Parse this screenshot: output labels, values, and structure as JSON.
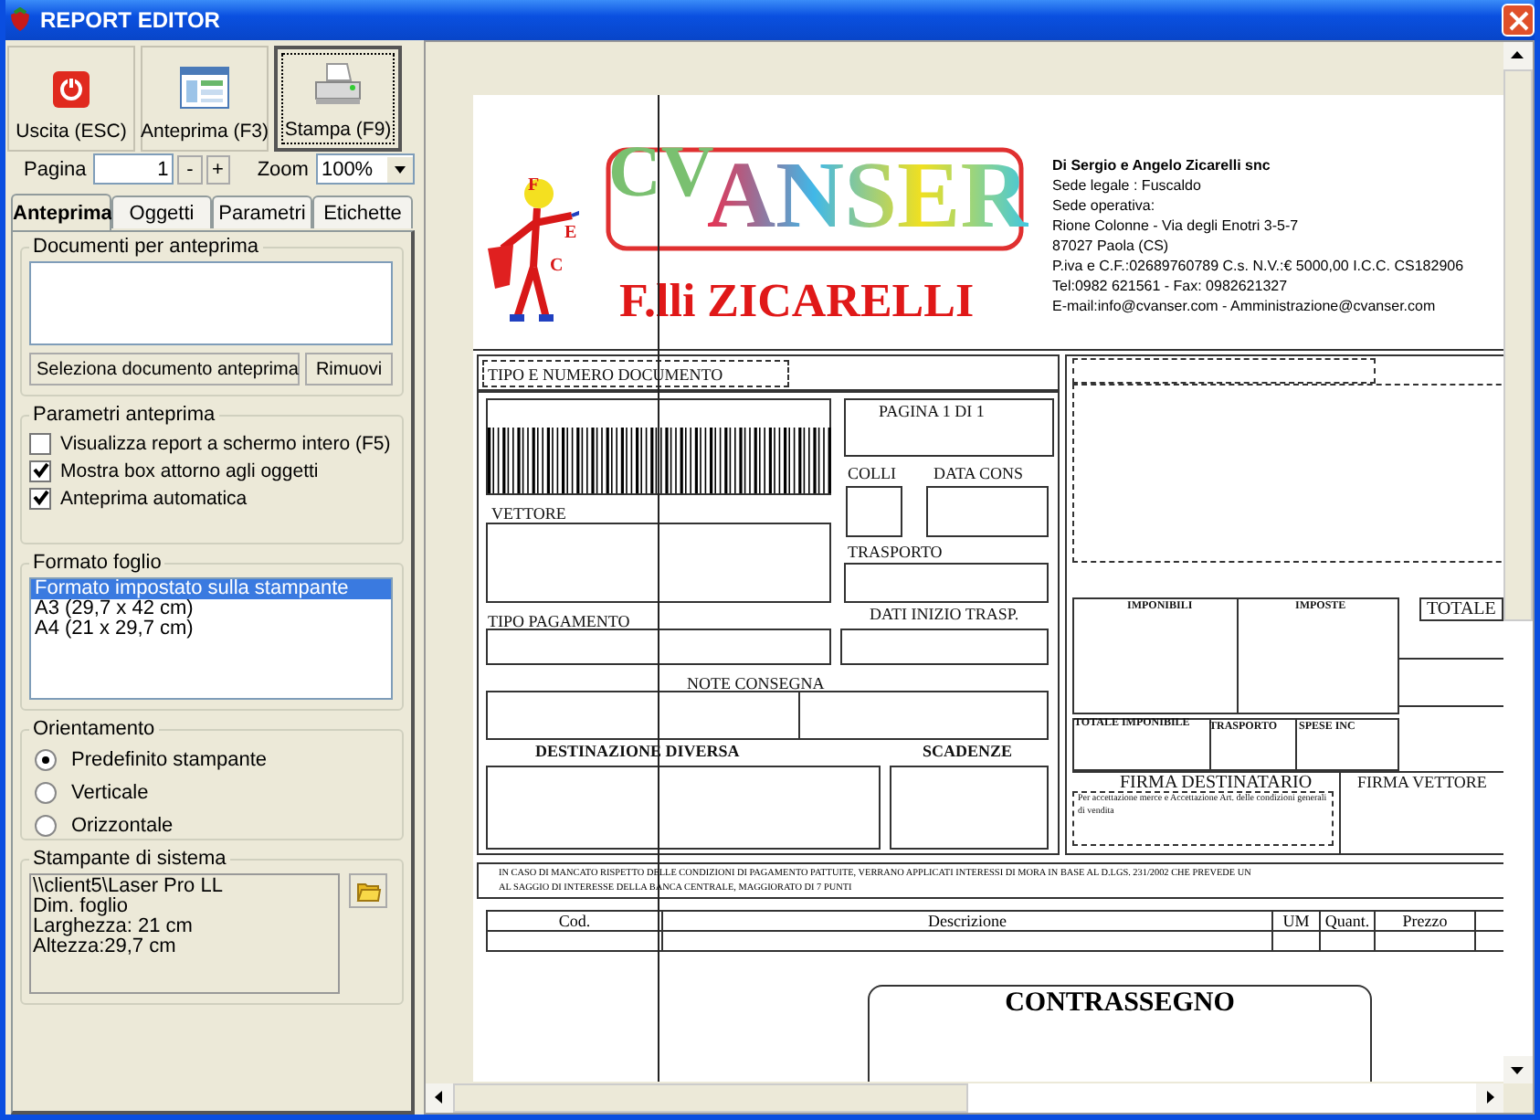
{
  "window": {
    "title": "REPORT EDITOR"
  },
  "toolbar": [
    {
      "label": "Uscita (ESC)",
      "kind": "exit",
      "selected": false
    },
    {
      "label": "Anteprima (F3)",
      "kind": "preview",
      "selected": false
    },
    {
      "label": "Stampa (F9)",
      "kind": "print",
      "selected": true
    }
  ],
  "pager": {
    "label": "Pagina",
    "value": "1",
    "minus": "-",
    "plus": "+",
    "zoom_label": "Zoom",
    "zoom_value": "100%"
  },
  "tabs": [
    {
      "label": "Anteprima",
      "selected": true
    },
    {
      "label": "Oggetti",
      "selected": false
    },
    {
      "label": "Parametri",
      "selected": false
    },
    {
      "label": "Etichette",
      "selected": false
    }
  ],
  "documents": {
    "title": "Documenti per anteprima",
    "buttons": [
      "Seleziona documento anteprima",
      "Rimuovi"
    ]
  },
  "preview_params": {
    "title": "Parametri anteprima",
    "options": [
      {
        "label": "Visualizza report a schermo intero (F5)",
        "checked": false
      },
      {
        "label": "Mostra box attorno agli oggetti",
        "checked": true
      },
      {
        "label": "Anteprima automatica",
        "checked": true
      }
    ]
  },
  "paper_format": {
    "title": "Formato foglio",
    "items": [
      {
        "label": "Formato impostato sulla stampante",
        "selected": true
      },
      {
        "label": "A3 (29,7 x 42 cm)",
        "selected": false
      },
      {
        "label": "A4 (21 x 29,7 cm)",
        "selected": false
      }
    ]
  },
  "orientation": {
    "title": "Orientamento",
    "options": [
      {
        "label": "Predefinito stampante",
        "selected": true
      },
      {
        "label": "Verticale",
        "selected": false
      },
      {
        "label": "Orizzontale",
        "selected": false
      }
    ]
  },
  "printer": {
    "title": "Stampante di sistema",
    "lines": [
      "\\\\client5\\Laser Pro LL",
      "Dim. foglio",
      "Larghezza: 21 cm",
      "Altezza:29,7 cm"
    ]
  },
  "report": {
    "logo": {
      "brand": "CV",
      "name": "ANSER",
      "subtitle": "F.lli ZICARELLI",
      "figure_letters": [
        "F",
        "E",
        "C"
      ]
    },
    "company": [
      "Di Sergio e Angelo Zicarelli snc",
      "Sede legale : Fuscaldo",
      "Sede operativa:",
      "Rione Colonne - Via degli Enotri 3-5-7",
      "87027 Paola (CS)",
      "P.iva e C.F.:02689760789 C.s. N.V.:€ 5000,00 I.C.C. CS182906",
      "Tel:0982 621561 - Fax: 0982621327",
      "E-mail:info@cvanser.com - Amministrazione@cvanser.com"
    ],
    "labels": [
      "TIPO E NUMERO DOCUMENTO",
      "PAGINA  1   DI   1",
      "COLLI",
      "DATA CONS",
      "VETTORE",
      "TRASPORTO",
      "TIPO PAGAMENTO",
      "DATI INIZIO TRASP.",
      "NOTE CONSEGNA",
      "DESTINAZIONE DIVERSA",
      "SCADENZE",
      "IMPONIBILI",
      "IMPOSTE",
      "TOTALE",
      "TOTALE IMPONIBILE",
      "TRASPORTO",
      "SPESE INC",
      "FIRMA DESTINATARIO",
      "FIRMA VETTORE",
      "Per accettazione merce e Accettazione Art. delle condizioni generali di vendita"
    ],
    "notice": [
      "IN CASO DI MANCATO RISPETTO DELLE CONDIZIONI DI PAGAMENTO PATTUITE, VERRANO APPLICATI INTERESSI DI MORA IN BASE AL D.LGS. 231/2002 CHE PREVEDE UN",
      "AL SAGGIO DI INTERESSE DELLA BANCA CENTRALE, MAGGIORATO DI 7 PUNTI"
    ],
    "columns": [
      "Cod.",
      "Descrizione",
      "UM",
      "Quant.",
      "Prezzo"
    ],
    "cod_box_title": "CONTRASSEGNO"
  }
}
